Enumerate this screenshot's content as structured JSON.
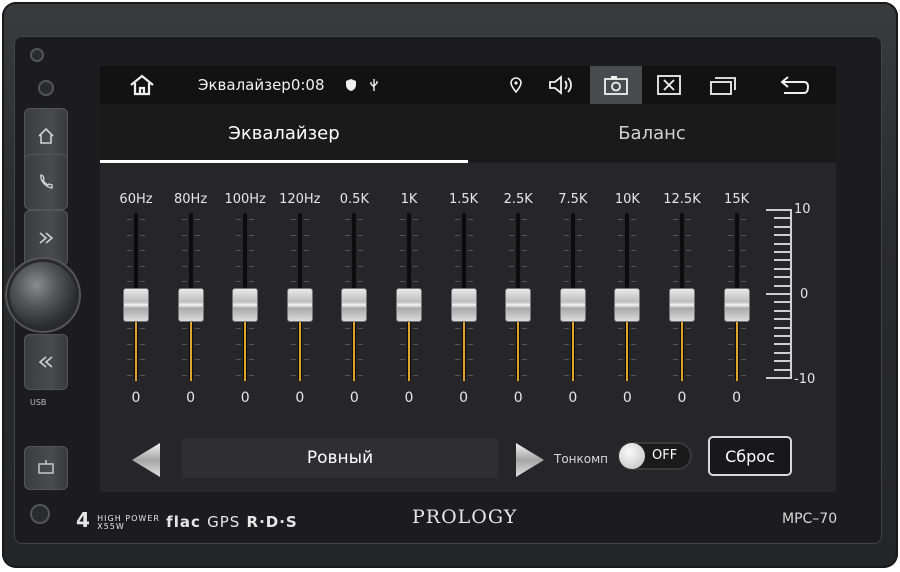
{
  "device": {
    "brand": "PROLOGY",
    "model": "MPC–70",
    "features": {
      "power_big": "4",
      "power_top": "HIGH POWER",
      "power_bottom": "X55W",
      "flac": "flac",
      "gps": "GPS",
      "rds": "R·D·S"
    },
    "usb_label": "USB"
  },
  "statusbar": {
    "title": "Эквалайзер0:08",
    "icons": [
      "home-icon",
      "shield-icon",
      "usb-icon",
      "location-icon",
      "volume-icon",
      "screenshot-icon",
      "close-app-icon",
      "recent-apps-icon",
      "back-icon"
    ]
  },
  "tabs": [
    {
      "label": "Эквалайзер",
      "active": true
    },
    {
      "label": "Баланс",
      "active": false
    }
  ],
  "bands": [
    {
      "label": "60Hz",
      "value": 0
    },
    {
      "label": "80Hz",
      "value": 0
    },
    {
      "label": "100Hz",
      "value": 0
    },
    {
      "label": "120Hz",
      "value": 0
    },
    {
      "label": "0.5K",
      "value": 0
    },
    {
      "label": "1K",
      "value": 0
    },
    {
      "label": "1.5K",
      "value": 0
    },
    {
      "label": "2.5K",
      "value": 0
    },
    {
      "label": "7.5K",
      "value": 0
    },
    {
      "label": "10K",
      "value": 0
    },
    {
      "label": "12.5K",
      "value": 0
    },
    {
      "label": "15K",
      "value": 0
    }
  ],
  "scale": {
    "max_label": "10",
    "mid_label": "0",
    "min_label": "-10",
    "range": [
      -10,
      10
    ]
  },
  "controls": {
    "preset": "Ровный",
    "tonekomp_label": "Тонкомп",
    "toggle_state": "OFF",
    "reset_label": "Сброс"
  },
  "colors": {
    "accent": "#e0a32a",
    "background": "#262628"
  }
}
